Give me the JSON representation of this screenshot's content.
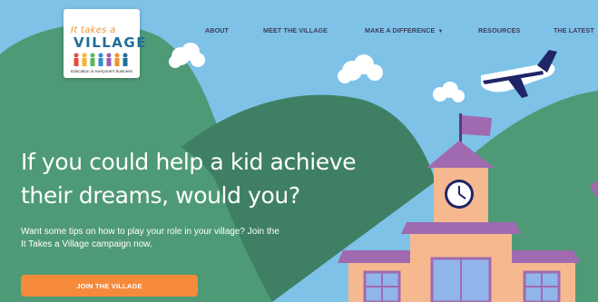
{
  "logo": {
    "line_top": "It takes a",
    "line_main": "VILLAGE",
    "tagline": "Education is everyone's business"
  },
  "nav": {
    "items": [
      {
        "label": "ABOUT"
      },
      {
        "label": "MEET THE VILLAGE"
      },
      {
        "label": "MAKE A DIFFERENCE",
        "has_dropdown": true
      },
      {
        "label": "RESOURCES"
      },
      {
        "label": "THE LATEST"
      }
    ],
    "dropdown_icon": "chevron-down-icon"
  },
  "hero": {
    "title": "If you could help a kid achieve their dreams, would you?",
    "subtitle": "Want some tips on how to play your role in your village? Join the It Takes a Village campaign now.",
    "cta_label": "JOIN THE VILLAGE"
  },
  "colors": {
    "sky": "#7ec2e8",
    "hill_light": "#4f9a76",
    "hill_dark": "#3f8065",
    "accent_orange": "#f58a3b",
    "nav_text": "#3e3e5b",
    "roof_purple": "#a06ab0",
    "building_peach": "#f6b98f",
    "window_blue": "#8fb5ea"
  }
}
